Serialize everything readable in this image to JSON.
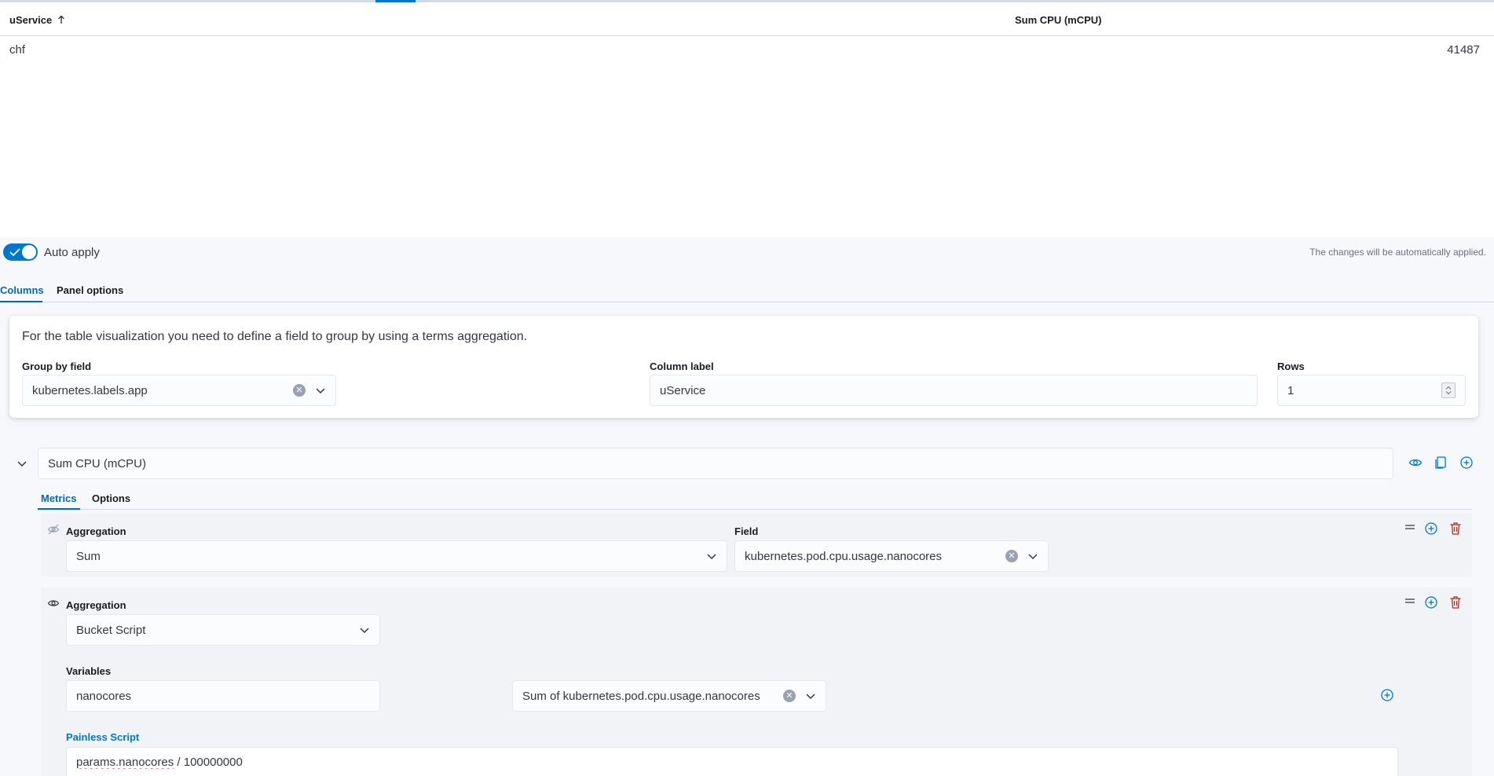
{
  "table": {
    "columns": [
      {
        "label": "uService",
        "sorted": "ascending"
      },
      {
        "label": "Sum CPU (mCPU)"
      }
    ],
    "rows": [
      {
        "uservice": "chf",
        "sum_cpu": "41487"
      }
    ]
  },
  "auto_apply": {
    "label": "Auto apply",
    "enabled": true,
    "status_text": "The changes will be automatically applied."
  },
  "editor_tabs": [
    {
      "label": "Columns",
      "active": true
    },
    {
      "label": "Panel options",
      "active": false
    }
  ],
  "group_by": {
    "description": "For the table visualization you need to define a field to group by using a terms aggregation.",
    "group_by_field_label": "Group by field",
    "group_by_field_value": "kubernetes.labels.app",
    "column_label_label": "Column label",
    "column_label_value": "uService",
    "rows_label": "Rows",
    "rows_value": "1"
  },
  "column": {
    "label_value": "Sum CPU (mCPU)",
    "tabs": [
      {
        "label": "Metrics",
        "active": true
      },
      {
        "label": "Options",
        "active": false
      }
    ],
    "metrics": [
      {
        "visible": false,
        "aggregation_label": "Aggregation",
        "aggregation_value": "Sum",
        "field_label": "Field",
        "field_value": "kubernetes.pod.cpu.usage.nanocores"
      },
      {
        "visible": true,
        "aggregation_label": "Aggregation",
        "aggregation_value": "Bucket Script",
        "variables_label": "Variables",
        "variable_name": "nanocores",
        "variable_metric": "Sum of kubernetes.pod.cpu.usage.nanocores",
        "script_label": "Painless Script",
        "script_var": "params.nanocores",
        "script_rest": " / 100000000"
      }
    ]
  },
  "colors": {
    "accent": "#0077cc",
    "delete": "#bd271e",
    "panel_bg": "#f7f8fc"
  }
}
